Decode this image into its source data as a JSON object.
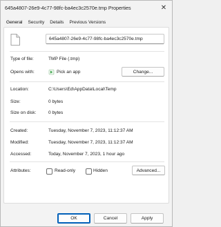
{
  "window": {
    "title": "645a4807-26e9-4c77-98fc-ba4ec3c2570e.tmp Properties",
    "close_glyph": "✕"
  },
  "tabs": [
    {
      "label": "General",
      "active": true
    },
    {
      "label": "Security",
      "active": false
    },
    {
      "label": "Details",
      "active": false
    },
    {
      "label": "Previous Versions",
      "active": false
    }
  ],
  "general": {
    "file_name": "645a4807-26e9-4c77-98fc-ba4ec3c2570e.tmp",
    "type_label": "Type of file:",
    "type_value": "TMP File (.tmp)",
    "opens_label": "Opens with:",
    "opens_value": "Pick an app",
    "change_button": "Change...",
    "location_label": "Location:",
    "location_value": "C:\\Users\\Ed\\AppData\\Local\\Temp",
    "size_label": "Size:",
    "size_value": "0 bytes",
    "size_disk_label": "Size on disk:",
    "size_disk_value": "0 bytes",
    "created_label": "Created:",
    "created_value": "Tuesday, November 7, 2023, 11:12:37 AM",
    "modified_label": "Modified:",
    "modified_value": "Tuesday, November 7, 2023, 11:12:37 AM",
    "accessed_label": "Accessed:",
    "accessed_value": "Today, November 7, 2023, 1 hour ago",
    "attributes_label": "Attributes:",
    "readonly_label": "Read-only",
    "hidden_label": "Hidden",
    "advanced_button": "Advanced..."
  },
  "footer": {
    "ok": "OK",
    "cancel": "Cancel",
    "apply": "Apply"
  },
  "colors": {
    "accent": "#005fb8",
    "window_bg": "#f3f3f3",
    "panel_bg": "#ffffff"
  }
}
